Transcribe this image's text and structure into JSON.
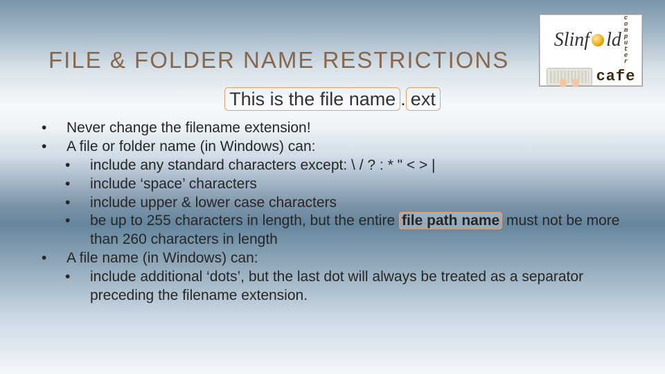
{
  "title": "FILE & FOLDER NAME RESTRICTIONS",
  "logo": {
    "brand": "Slinf",
    "brand2": "ld",
    "side": "mputer",
    "cafe": "cafe"
  },
  "example": {
    "filename": "This is the file name",
    "dot": ".",
    "ext": "ext"
  },
  "bullets": {
    "a": "Never change the filename extension!",
    "b": "A file or folder name (in Windows) can:",
    "b1": "include any standard characters except: \\ / ? : * \" < > |",
    "b2": "include ‘space’ characters",
    "b3": "include upper & lower case characters",
    "b4a": "be up to 255 characters in length, but the entire",
    "b4h": "file path name",
    "b4b": "must not be more than 260 characters in length",
    "c": "A file name (in Windows) can:",
    "c1": "include additional ‘dots’, but the last dot will always be treated as a separator preceding the filename extension."
  }
}
